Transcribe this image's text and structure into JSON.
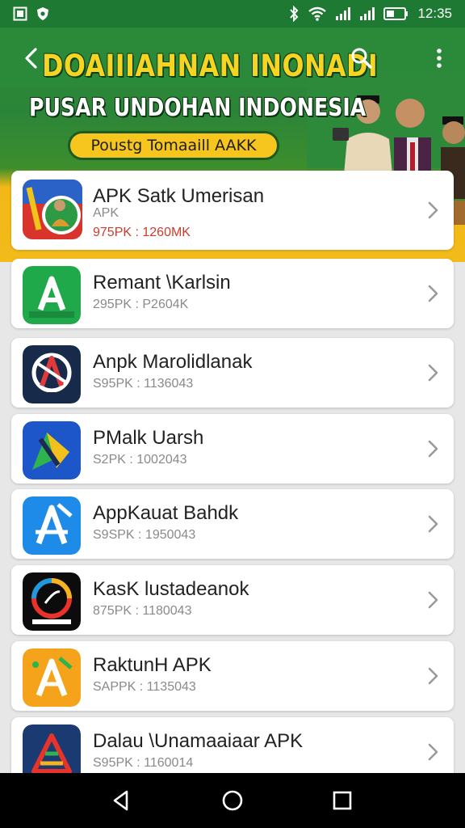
{
  "status_bar": {
    "time": "12:35",
    "icons": [
      "gallery-icon",
      "shield-icon",
      "bluetooth-icon",
      "wifi-icon",
      "signal-icon",
      "signal-icon",
      "battery-icon"
    ]
  },
  "banner": {
    "title": "DOAIIIAHNAN INONADI",
    "subtitle": "PUSAR UNDOHAN INDONESIA",
    "pill_label": "Poustg Tomaaill AAKK",
    "colors": {
      "green": "#2b8a3a",
      "yellow": "#f3bb1a",
      "title_yellow": "#f5d522"
    }
  },
  "toolbar": {
    "back_icon": "back-arrow-icon",
    "search_icon": "search-icon",
    "more_icon": "more-vert-icon"
  },
  "apps": [
    {
      "name": "APK Satk Umerisan",
      "type": "APK",
      "meta": "975PK : 1260MK",
      "meta_color": "#d23a2c",
      "icon": "app-icon-1"
    },
    {
      "name": "Remant \\Karlsin",
      "meta": "295PK : P2604K",
      "icon": "app-icon-2"
    },
    {
      "name": "Anpk Marolidlanak",
      "meta": "S95PK : 1136043",
      "icon": "app-icon-3"
    },
    {
      "name": "PMalk Uarsh",
      "meta": "S2PK : 1002043",
      "icon": "app-icon-4"
    },
    {
      "name": "AppKauat Bahdk",
      "meta": "S9SPK : 1950043",
      "icon": "app-icon-5"
    },
    {
      "name": "KasK lustadeanok",
      "meta": "875PK : 1180043",
      "icon": "app-icon-6"
    },
    {
      "name": "RaktunH APK",
      "meta": "SAPPK : 1135043",
      "icon": "app-icon-7"
    },
    {
      "name": "Dalau \\Unamaaiaar APK",
      "meta": "S95PK : 1160014",
      "icon": "app-icon-8"
    }
  ],
  "nav_bar": {
    "icons": [
      "nav-back-icon",
      "nav-home-icon",
      "nav-recents-icon"
    ]
  }
}
